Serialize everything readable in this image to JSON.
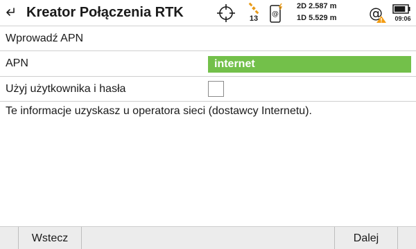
{
  "header": {
    "title": "Kreator Połączenia RTK",
    "satellites_count": "13",
    "quality_2d": "2D 2.587 m",
    "quality_1d": "1D 5.529 m",
    "time": "09:06",
    "battery_level": 0.85
  },
  "form": {
    "section_title": "Wprowadź APN",
    "apn_label": "APN",
    "apn_value": "internet",
    "use_user_label": "Użyj użytkownika i hasła",
    "info_text": "Te informacje uzyskasz u operatora sieci (dostawcy Internetu)."
  },
  "footer": {
    "back_label": "Wstecz",
    "next_label": "Dalej"
  },
  "colors": {
    "accent_green": "#73c04a",
    "warning_orange": "#f39c12",
    "sat_orange": "#e89b1a"
  }
}
